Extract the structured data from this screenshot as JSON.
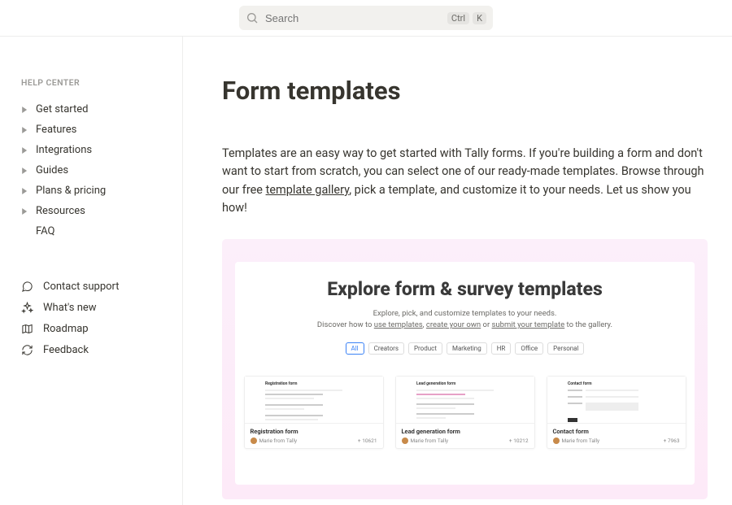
{
  "search": {
    "placeholder": "Search",
    "kbd1": "Ctrl",
    "kbd2": "K"
  },
  "sidebar": {
    "heading": "HELP CENTER",
    "items": [
      {
        "label": "Get started"
      },
      {
        "label": "Features"
      },
      {
        "label": "Integrations"
      },
      {
        "label": "Guides"
      },
      {
        "label": "Plans & pricing"
      },
      {
        "label": "Resources"
      },
      {
        "label": "FAQ"
      }
    ],
    "secondary": [
      {
        "label": "Contact support"
      },
      {
        "label": "What's new"
      },
      {
        "label": "Roadmap"
      },
      {
        "label": "Feedback"
      }
    ]
  },
  "page": {
    "title": "Form templates",
    "intro_a": "Templates are an easy way to get started with Tally forms. If you're building a form and don't want to start from scratch, you can select one of our ready-made templates. Browse through our free ",
    "intro_link": "template gallery",
    "intro_b": ", pick a template, and customize it to your needs. Let us show you how!"
  },
  "hero": {
    "title": "Explore form & survey templates",
    "sub_line1": "Explore, pick, and customize templates to your needs.",
    "sub_pre": "Discover how to ",
    "sub_u1": "use templates",
    "sub_sep1": ", ",
    "sub_u2": "create your own",
    "sub_sep2": " or ",
    "sub_u3": "submit your template",
    "sub_post": " to the gallery.",
    "filters": [
      "All",
      "Creators",
      "Product",
      "Marketing",
      "HR",
      "Office",
      "Personal"
    ],
    "cards": [
      {
        "preview_title": "Registration form",
        "title": "Registration form",
        "author": "Marie from Tally",
        "metric": "+  10621"
      },
      {
        "preview_title": "Lead generation form",
        "title": "Lead generation form",
        "author": "Marie from Tally",
        "metric": "+  10212"
      },
      {
        "preview_title": "Contact form",
        "title": "Contact form",
        "author": "Marie from Tally",
        "metric": "+  7963"
      }
    ]
  }
}
